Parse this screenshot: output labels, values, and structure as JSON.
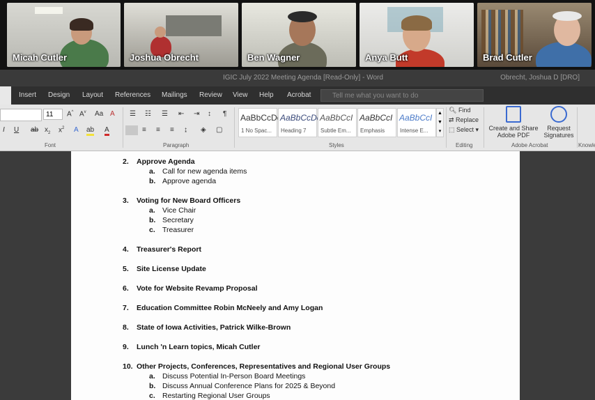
{
  "participants": [
    {
      "name": "Micah Cutler"
    },
    {
      "name": "Joshua Obrecht"
    },
    {
      "name": "Ben Wagner"
    },
    {
      "name": "Anya Butt"
    },
    {
      "name": "Brad Cutler"
    }
  ],
  "window": {
    "title": "IGIC July 2022 Meeting Agenda [Read-Only]  -  Word",
    "user": "Obrecht, Joshua D [DRO]"
  },
  "menu": {
    "tabs": [
      "Insert",
      "Design",
      "Layout",
      "References",
      "Mailings",
      "Review",
      "View",
      "Help",
      "Acrobat"
    ],
    "search_placeholder": "Tell me what you want to do"
  },
  "ribbon": {
    "font_size": "11",
    "styles": [
      {
        "sample": "AaBbCcDc",
        "name": "1 No Spac..."
      },
      {
        "sample": "AaBbCcDc",
        "name": "Heading 7"
      },
      {
        "sample": "AaBbCcI",
        "name": "Subtle Em..."
      },
      {
        "sample": "AaBbCcI",
        "name": "Emphasis"
      },
      {
        "sample": "AaBbCcI",
        "name": "Intense E..."
      }
    ],
    "editing": {
      "find": "Find",
      "replace": "Replace",
      "select": "Select"
    },
    "acrobat": {
      "create": "Create and Share",
      "create2": "Adobe PDF",
      "request": "Request",
      "request2": "Signatures"
    },
    "groups": {
      "font": "Font",
      "paragraph": "Paragraph",
      "styles": "Styles",
      "editing": "Editing",
      "adobe": "Adobe Acrobat",
      "knowledge": "Knowle"
    }
  },
  "document": {
    "items": [
      {
        "num": "2.",
        "title": "Approve Agenda",
        "subs": [
          {
            "l": "a.",
            "t": "Call for new agenda items"
          },
          {
            "l": "b.",
            "t": "Approve agenda"
          }
        ]
      },
      {
        "num": "3.",
        "title": "Voting for New Board Officers",
        "subs": [
          {
            "l": "a.",
            "t": "Vice Chair"
          },
          {
            "l": "b.",
            "t": "Secretary"
          },
          {
            "l": "c.",
            "t": "Treasurer"
          }
        ]
      },
      {
        "num": "4.",
        "title": "Treasurer's Report"
      },
      {
        "num": "5.",
        "title": "Site License Update"
      },
      {
        "num": "6.",
        "title": "Vote for Website Revamp Proposal"
      },
      {
        "num": "7.",
        "title": "Education Committee Robin McNeely and Amy Logan"
      },
      {
        "num": "8.",
        "title": "State of Iowa Activities, Patrick Wilke-Brown"
      },
      {
        "num": "9.",
        "title": "Lunch 'n Learn topics, Micah Cutler"
      },
      {
        "num": "10.",
        "title": "Other Projects, Conferences, Representatives and Regional User Groups",
        "subs": [
          {
            "l": "a.",
            "t": "Discuss Potential In-Person Board Meetings"
          },
          {
            "l": "b.",
            "t": "Discuss Annual Conference Plans for 2025 & Beyond"
          },
          {
            "l": "c.",
            "t": "Restarting Regional User Groups"
          }
        ]
      }
    ]
  }
}
